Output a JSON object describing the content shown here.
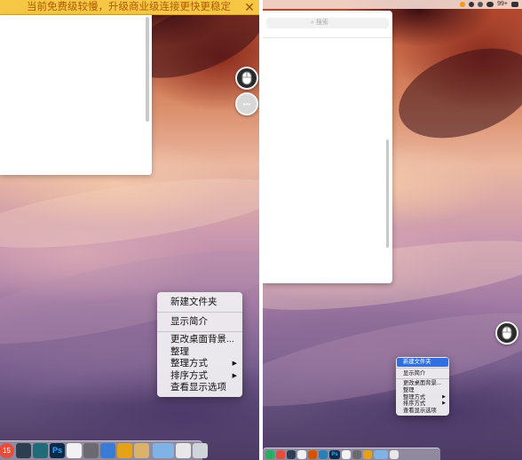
{
  "left": {
    "banner_text": "当前免费级较慢，升级商业级连接更快更稳定",
    "banner_close_glyph": "✕",
    "banner_color": "#f6c744",
    "more_glyph": "•••",
    "context_menu": {
      "new_folder": "新建文件夹",
      "get_info": "显示简介",
      "change_wallpaper": "更改桌面背景...",
      "clean_up": "整理",
      "clean_up_by": "整理方式",
      "sort_by": "排序方式",
      "show_view_options": "查看显示选项",
      "submenu_arrow": "▶"
    },
    "dock_badge": "15",
    "dock_ps_label": "Ps"
  },
  "right": {
    "menubar_battery": "99+",
    "search_placeholder": "搜索",
    "context_menu": {
      "new_folder": "新建文件夹",
      "get_info": "显示简介",
      "change_wallpaper": "更改桌面背景...",
      "clean_up": "整理",
      "clean_up_by": "整理方式",
      "sort_by": "排序方式",
      "show_view_options": "查看显示选项",
      "submenu_arrow": "▶"
    },
    "dock_ps_label": "Ps"
  },
  "colors": {
    "menu_highlight": "#2f6fe0",
    "banner_text": "#b05a00"
  }
}
